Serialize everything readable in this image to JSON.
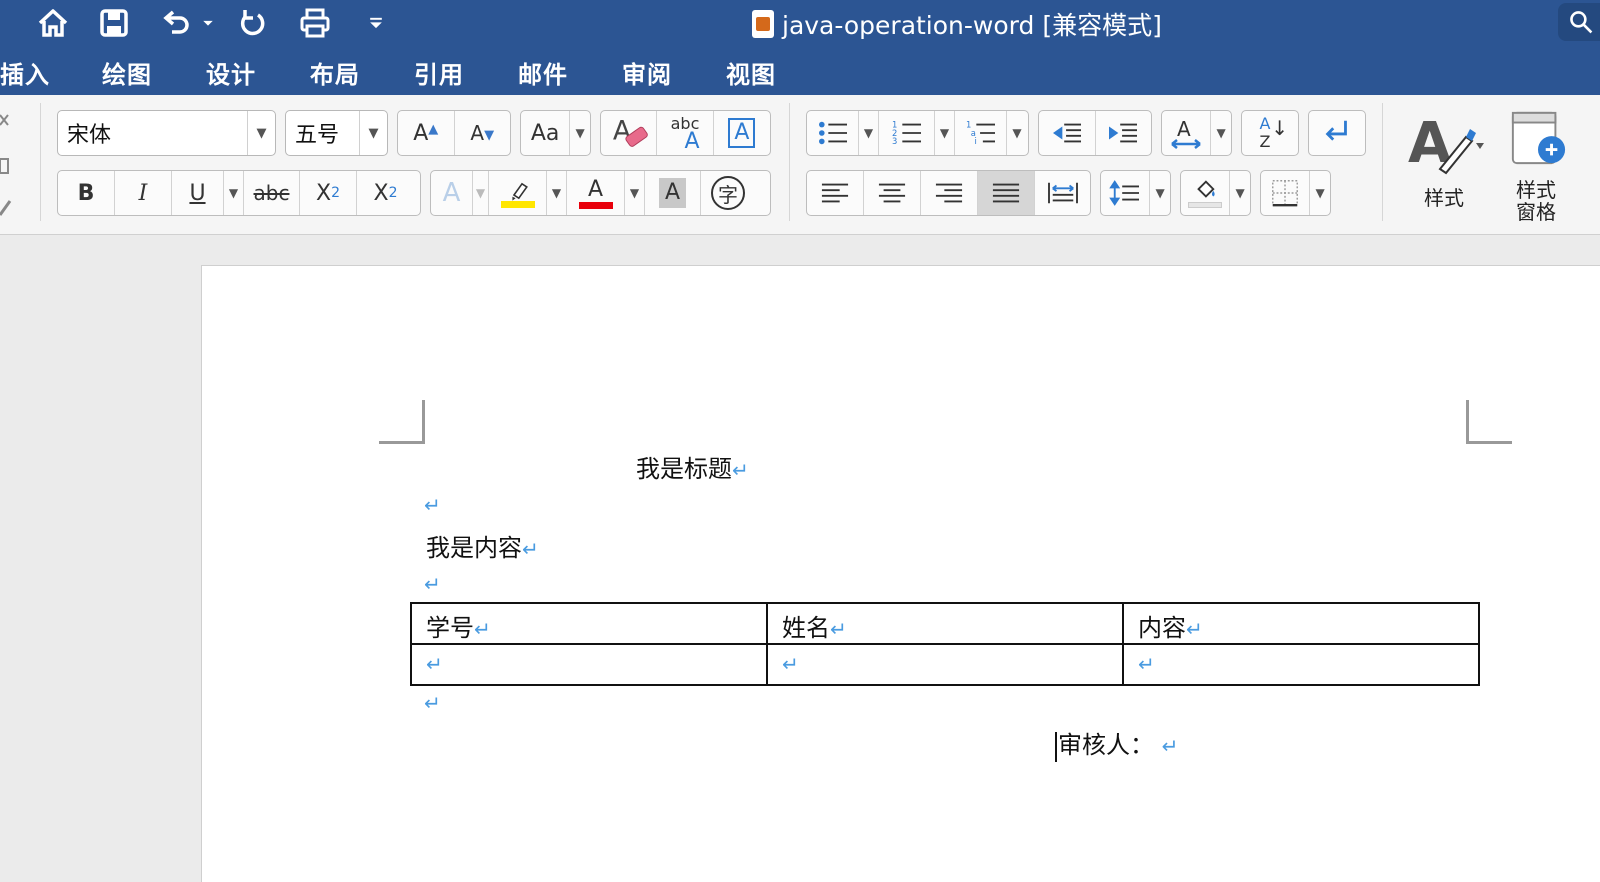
{
  "title_bar": {
    "document_title": "java-operation-word [兼容模式]",
    "quick_access_icons": [
      "home-icon",
      "save-icon",
      "undo-icon",
      "redo-icon",
      "print-icon",
      "customize-icon"
    ]
  },
  "menu": {
    "tabs": [
      "插入",
      "绘图",
      "设计",
      "布局",
      "引用",
      "邮件",
      "审阅",
      "视图"
    ]
  },
  "ribbon": {
    "font_name": "宋体",
    "font_size": "五号",
    "grow_font": "A",
    "shrink_font": "A",
    "change_case": "Aa",
    "abc_label": "abc",
    "char_border": "A",
    "bold": "B",
    "italic": "I",
    "underline": "U",
    "strikethrough": "abc",
    "subscript": "X",
    "subscript_mark": "2",
    "superscript": "X",
    "superscript_mark": "2",
    "text_effects": "A",
    "font_color": "A",
    "char_shading": "A",
    "enclose_char": "字",
    "sort_a": "A",
    "sort_z": "Z",
    "styles_label": "样式",
    "styles_pane_label": "样式\n窗格",
    "colors": {
      "accent": "#2c5593",
      "highlight": "#ffe600",
      "font_color": "#e8000b",
      "paragraph_mark": "#4a9be0"
    }
  },
  "document": {
    "title": "我是标题",
    "content": "我是内容",
    "paragraph_mark": "↵",
    "table": {
      "headers": [
        "学号",
        "姓名",
        "内容"
      ],
      "rows": [
        [
          "",
          "",
          ""
        ]
      ]
    },
    "reviewer": "审核人："
  }
}
